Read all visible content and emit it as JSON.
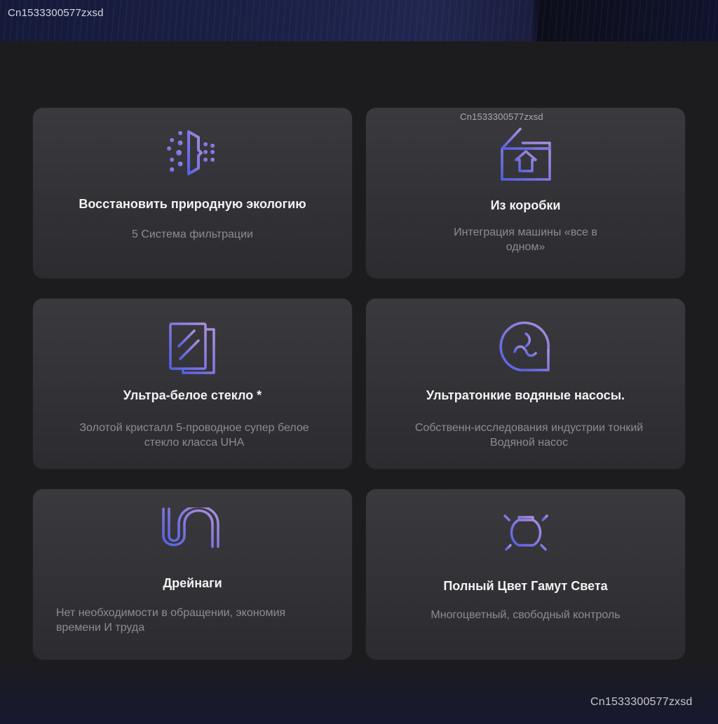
{
  "watermarks": {
    "top": "Cn1533300577zxsd",
    "card": "Cn1533300577zxsd",
    "bottom": "Cn1533300577zxsd"
  },
  "features": [
    {
      "icon": "filter-spray-icon",
      "title": "Восстановить природную экологию",
      "desc": "5 Система фильтрации"
    },
    {
      "icon": "box-upload-icon",
      "title": "Из коробки",
      "desc": "Интеграция машины «все в одном»"
    },
    {
      "icon": "glass-panel-icon",
      "title": "Ультра-белое стекло *",
      "desc": "Золотой кристалл 5-проводное супер белое стекло класса UHA"
    },
    {
      "icon": "water-pump-icon",
      "title": "Ультратонкие водяные насосы.",
      "desc": "Собственн-исследования индустрии тонкий Водяной насос"
    },
    {
      "icon": "drain-pipe-icon",
      "title": "Дрейнаги",
      "desc": "Нет необходимости в обращении, экономия времени И труда"
    },
    {
      "icon": "light-bulb-icon",
      "title": "Полный Цвет Гамут Света",
      "desc": "Многоцветный, свободный контроль"
    }
  ],
  "colors": {
    "icon_gradient_start": "#5b66e8",
    "icon_gradient_end": "#a58be0",
    "background": "#1c1c1e",
    "card": "#333337"
  }
}
